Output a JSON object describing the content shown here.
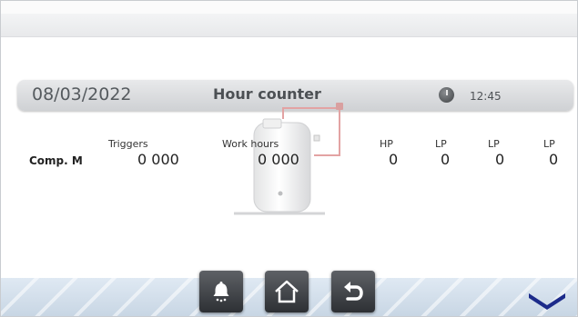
{
  "info_bar": {
    "date": "08/03/2022",
    "title": "Hour counter",
    "time": "12:45"
  },
  "table": {
    "headers": {
      "triggers": "Triggers",
      "work_hours": "Work hours",
      "hp": "HP",
      "lp1": "LP",
      "lp2": "LP",
      "lp3": "LP"
    },
    "row": {
      "label": "Comp. M",
      "triggers": "0 000",
      "work_hours": "0 000",
      "hp": "0",
      "lp1": "0",
      "lp2": "0",
      "lp3": "0"
    }
  },
  "icons": {
    "clock": "clock-icon",
    "alarm": "alarm-bell-icon",
    "home": "home-icon",
    "back": "back-arrow-icon",
    "scroll_down": "chevron-down-icon",
    "compressor": "compressor-illustration"
  },
  "colors": {
    "button_dark": "#3a3d41",
    "chevron": "#1c2b8a",
    "pipe": "#e08a8a"
  }
}
